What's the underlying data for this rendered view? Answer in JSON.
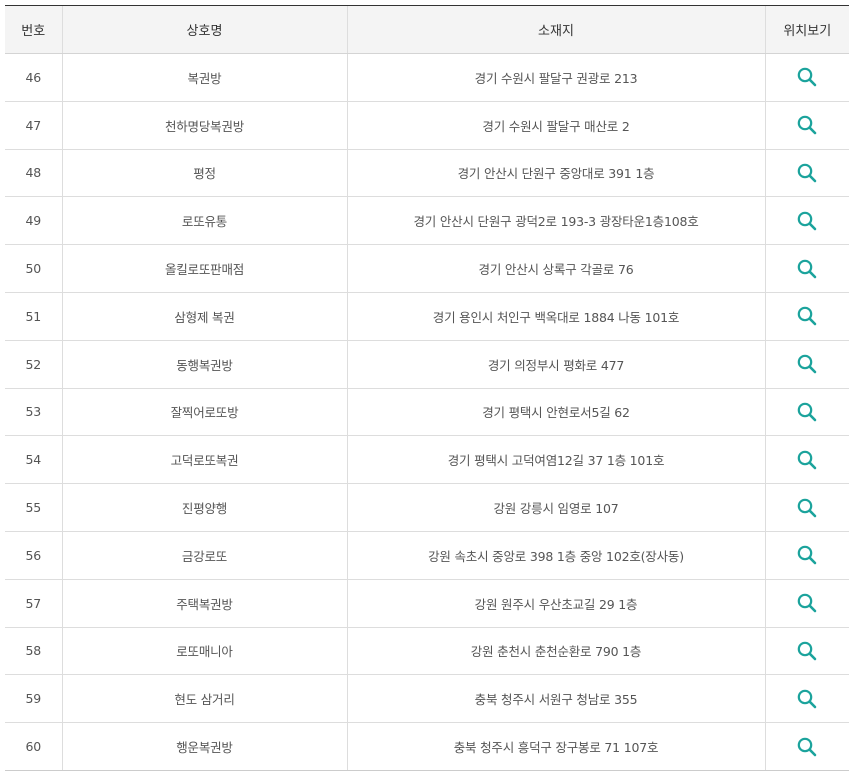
{
  "table": {
    "headers": {
      "no": "번호",
      "name": "상호명",
      "address": "소재지",
      "map": "위치보기"
    },
    "rows": [
      {
        "no": "46",
        "name": "복권방",
        "address": "경기 수원시 팔달구 권광로 213"
      },
      {
        "no": "47",
        "name": "천하명당복권방",
        "address": "경기 수원시 팔달구 매산로 2"
      },
      {
        "no": "48",
        "name": "평정",
        "address": "경기 안산시 단원구 중앙대로 391 1층"
      },
      {
        "no": "49",
        "name": "로또유통",
        "address": "경기 안산시 단원구 광덕2로 193-3 광장타운1층108호"
      },
      {
        "no": "50",
        "name": "올킬로또판매점",
        "address": "경기 안산시 상록구 각골로 76"
      },
      {
        "no": "51",
        "name": "삼형제 복권",
        "address": "경기 용인시 처인구 백옥대로 1884 나동 101호"
      },
      {
        "no": "52",
        "name": "동행복권방",
        "address": "경기 의정부시 평화로 477"
      },
      {
        "no": "53",
        "name": "잘찍어로또방",
        "address": "경기 평택시 안현로서5길 62"
      },
      {
        "no": "54",
        "name": "고덕로또복권",
        "address": "경기 평택시 고덕여염12길 37 1층 101호"
      },
      {
        "no": "55",
        "name": "진평양행",
        "address": "강원 강릉시 임영로 107"
      },
      {
        "no": "56",
        "name": "금강로또",
        "address": "강원 속초시 중앙로 398 1층 중앙 102호(장사동)"
      },
      {
        "no": "57",
        "name": "주택복권방",
        "address": "강원 원주시 우산초교길 29 1층"
      },
      {
        "no": "58",
        "name": "로또매니아",
        "address": "강원 춘천시 춘천순환로 790 1층"
      },
      {
        "no": "59",
        "name": "현도 삼거리",
        "address": "충북 청주시 서원구 청남로 355"
      },
      {
        "no": "60",
        "name": "행운복권방",
        "address": "충북 청주시 흥덕구 장구봉로 71 107호"
      }
    ]
  },
  "icons": {
    "map": "search-icon"
  },
  "colors": {
    "accent": "#1ba39c",
    "header_bg": "#f4f4f4",
    "top_border": "#333333",
    "grid": "#dddddd",
    "text": "#555555"
  }
}
